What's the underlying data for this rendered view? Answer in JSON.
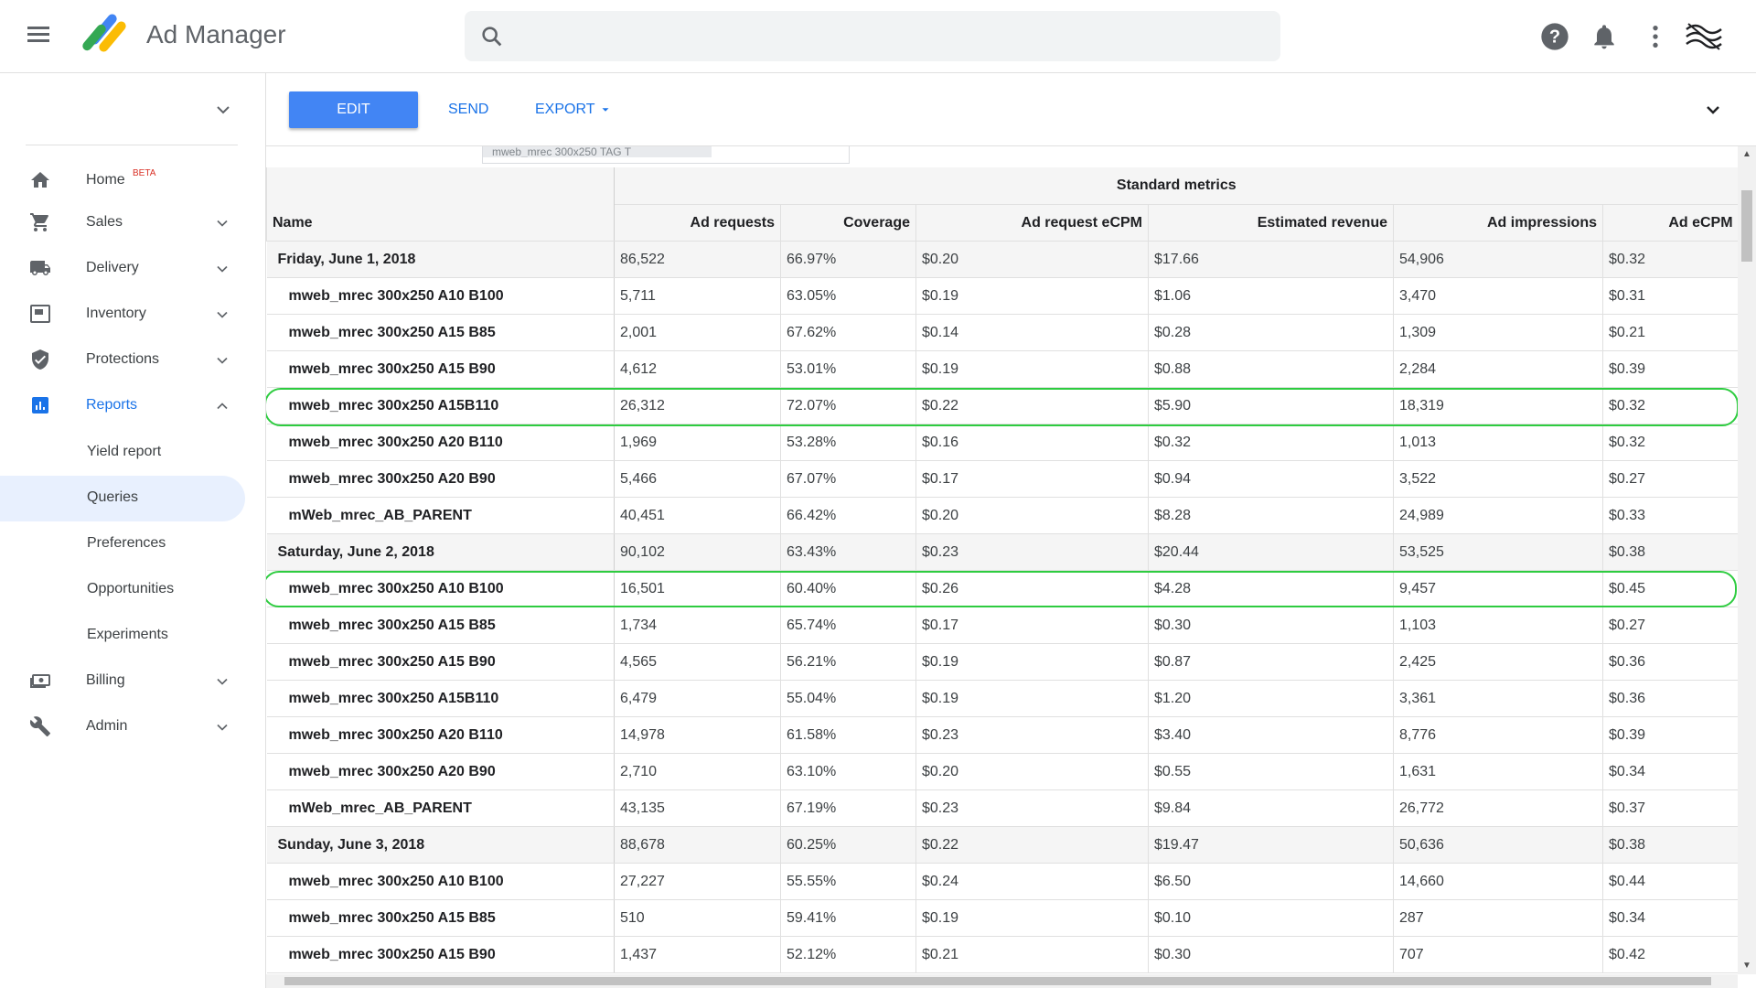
{
  "app": {
    "title": "Ad Manager",
    "search_placeholder": ""
  },
  "header_icons": [
    "help-icon",
    "notifications-icon",
    "more-vert-icon",
    "account-logo-icon"
  ],
  "toolbar": {
    "edit_label": "EDIT",
    "send_label": "SEND",
    "export_label": "EXPORT"
  },
  "sidebar": {
    "home_label": "Home",
    "home_badge": "BETA",
    "sales_label": "Sales",
    "delivery_label": "Delivery",
    "inventory_label": "Inventory",
    "protections_label": "Protections",
    "reports_label": "Reports",
    "reports_sub": {
      "yield": "Yield report",
      "queries": "Queries",
      "preferences": "Preferences",
      "opportunities": "Opportunities",
      "experiments": "Experiments"
    },
    "billing_label": "Billing",
    "admin_label": "Admin"
  },
  "filter_chip": "mweb_mrec 300x250 TAG T",
  "table": {
    "group_header": "Standard metrics",
    "name_header": "Name",
    "columns": [
      "Ad requests",
      "Coverage",
      "Ad request eCPM",
      "Estimated revenue",
      "Ad impressions",
      "Ad eCPM"
    ],
    "rows": [
      {
        "type": "day",
        "name": "Friday, June 1, 2018",
        "cells": [
          "86,522",
          "66.97%",
          "$0.20",
          "$17.66",
          "54,906",
          "$0.32"
        ]
      },
      {
        "type": "item",
        "name": "mweb_mrec 300x250 A10 B100",
        "cells": [
          "5,711",
          "63.05%",
          "$0.19",
          "$1.06",
          "3,470",
          "$0.31"
        ]
      },
      {
        "type": "item",
        "name": "mweb_mrec 300x250 A15 B85",
        "cells": [
          "2,001",
          "67.62%",
          "$0.14",
          "$0.28",
          "1,309",
          "$0.21"
        ]
      },
      {
        "type": "item",
        "name": "mweb_mrec 300x250 A15 B90",
        "cells": [
          "4,612",
          "53.01%",
          "$0.19",
          "$0.88",
          "2,284",
          "$0.39"
        ]
      },
      {
        "type": "item",
        "name": "mweb_mrec 300x250 A15B110",
        "cells": [
          "26,312",
          "72.07%",
          "$0.22",
          "$5.90",
          "18,319",
          "$0.32"
        ],
        "highlight": true
      },
      {
        "type": "item",
        "name": "mweb_mrec 300x250 A20 B110",
        "cells": [
          "1,969",
          "53.28%",
          "$0.16",
          "$0.32",
          "1,013",
          "$0.32"
        ]
      },
      {
        "type": "item",
        "name": "mweb_mrec 300x250 A20 B90",
        "cells": [
          "5,466",
          "67.07%",
          "$0.17",
          "$0.94",
          "3,522",
          "$0.27"
        ]
      },
      {
        "type": "item",
        "name": "mWeb_mrec_AB_PARENT",
        "cells": [
          "40,451",
          "66.42%",
          "$0.20",
          "$8.28",
          "24,989",
          "$0.33"
        ]
      },
      {
        "type": "day",
        "name": "Saturday, June 2, 2018",
        "cells": [
          "90,102",
          "63.43%",
          "$0.23",
          "$20.44",
          "53,525",
          "$0.38"
        ]
      },
      {
        "type": "item",
        "name": "mweb_mrec 300x250 A10 B100",
        "cells": [
          "16,501",
          "60.40%",
          "$0.26",
          "$4.28",
          "9,457",
          "$0.45"
        ],
        "highlight": true
      },
      {
        "type": "item",
        "name": "mweb_mrec 300x250 A15 B85",
        "cells": [
          "1,734",
          "65.74%",
          "$0.17",
          "$0.30",
          "1,103",
          "$0.27"
        ]
      },
      {
        "type": "item",
        "name": "mweb_mrec 300x250 A15 B90",
        "cells": [
          "4,565",
          "56.21%",
          "$0.19",
          "$0.87",
          "2,425",
          "$0.36"
        ]
      },
      {
        "type": "item",
        "name": "mweb_mrec 300x250 A15B110",
        "cells": [
          "6,479",
          "55.04%",
          "$0.19",
          "$1.20",
          "3,361",
          "$0.36"
        ]
      },
      {
        "type": "item",
        "name": "mweb_mrec 300x250 A20 B110",
        "cells": [
          "14,978",
          "61.58%",
          "$0.23",
          "$3.40",
          "8,776",
          "$0.39"
        ]
      },
      {
        "type": "item",
        "name": "mweb_mrec 300x250 A20 B90",
        "cells": [
          "2,710",
          "63.10%",
          "$0.20",
          "$0.55",
          "1,631",
          "$0.34"
        ]
      },
      {
        "type": "item",
        "name": "mWeb_mrec_AB_PARENT",
        "cells": [
          "43,135",
          "67.19%",
          "$0.23",
          "$9.84",
          "26,772",
          "$0.37"
        ]
      },
      {
        "type": "day",
        "name": "Sunday, June 3, 2018",
        "cells": [
          "88,678",
          "60.25%",
          "$0.22",
          "$19.47",
          "50,636",
          "$0.38"
        ]
      },
      {
        "type": "item",
        "name": "mweb_mrec 300x250 A10 B100",
        "cells": [
          "27,227",
          "55.55%",
          "$0.24",
          "$6.50",
          "14,660",
          "$0.44"
        ]
      },
      {
        "type": "item",
        "name": "mweb_mrec 300x250 A15 B85",
        "cells": [
          "510",
          "59.41%",
          "$0.19",
          "$0.10",
          "287",
          "$0.34"
        ]
      },
      {
        "type": "item",
        "name": "mweb_mrec 300x250 A15 B90",
        "cells": [
          "1,437",
          "52.12%",
          "$0.21",
          "$0.30",
          "707",
          "$0.42"
        ]
      }
    ]
  },
  "colors": {
    "primary": "#4285f4",
    "link": "#1a73e8",
    "highlight": "#2ecc40",
    "selected_bg": "#e8f0fe"
  }
}
